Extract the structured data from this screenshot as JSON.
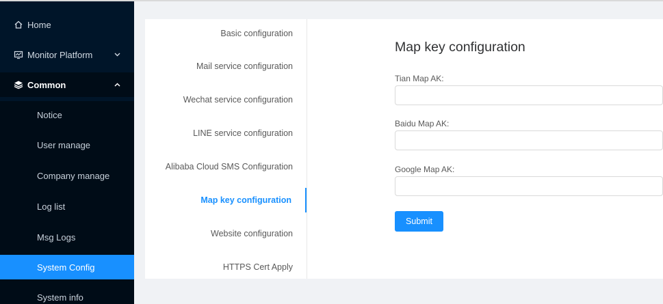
{
  "sidebar": {
    "home": {
      "label": "Home",
      "icon": "home-icon"
    },
    "monitor": {
      "label": "Monitor Platform",
      "icon": "monitor-icon",
      "chevron": "chevron-down-icon"
    },
    "common": {
      "label": "Common",
      "icon": "stack-icon",
      "chevron": "chevron-up-icon"
    },
    "submenu": [
      {
        "label": "Notice"
      },
      {
        "label": "User manage"
      },
      {
        "label": "Company manage"
      },
      {
        "label": "Log list"
      },
      {
        "label": "Msg Logs"
      },
      {
        "label": "System Config",
        "active": true
      },
      {
        "label": "System info"
      }
    ]
  },
  "config_tabs": [
    {
      "label": "Basic configuration"
    },
    {
      "label": "Mail service configuration"
    },
    {
      "label": "Wechat service configuration"
    },
    {
      "label": "LINE service configuration"
    },
    {
      "label": "Alibaba Cloud SMS Configuration"
    },
    {
      "label": "Map key configuration",
      "active": true
    },
    {
      "label": "Website configuration"
    },
    {
      "label": "HTTPS Cert Apply"
    }
  ],
  "content": {
    "title": "Map key configuration",
    "fields": [
      {
        "label": "Tian Map AK:",
        "value": ""
      },
      {
        "label": "Baidu Map AK:",
        "value": ""
      },
      {
        "label": "Google Map AK:",
        "value": ""
      }
    ],
    "submit_label": "Submit"
  },
  "colors": {
    "sidebar_bg": "#001529",
    "submenu_bg": "#000c17",
    "accent": "#1890ff",
    "page_bg": "#f0f2f5"
  }
}
